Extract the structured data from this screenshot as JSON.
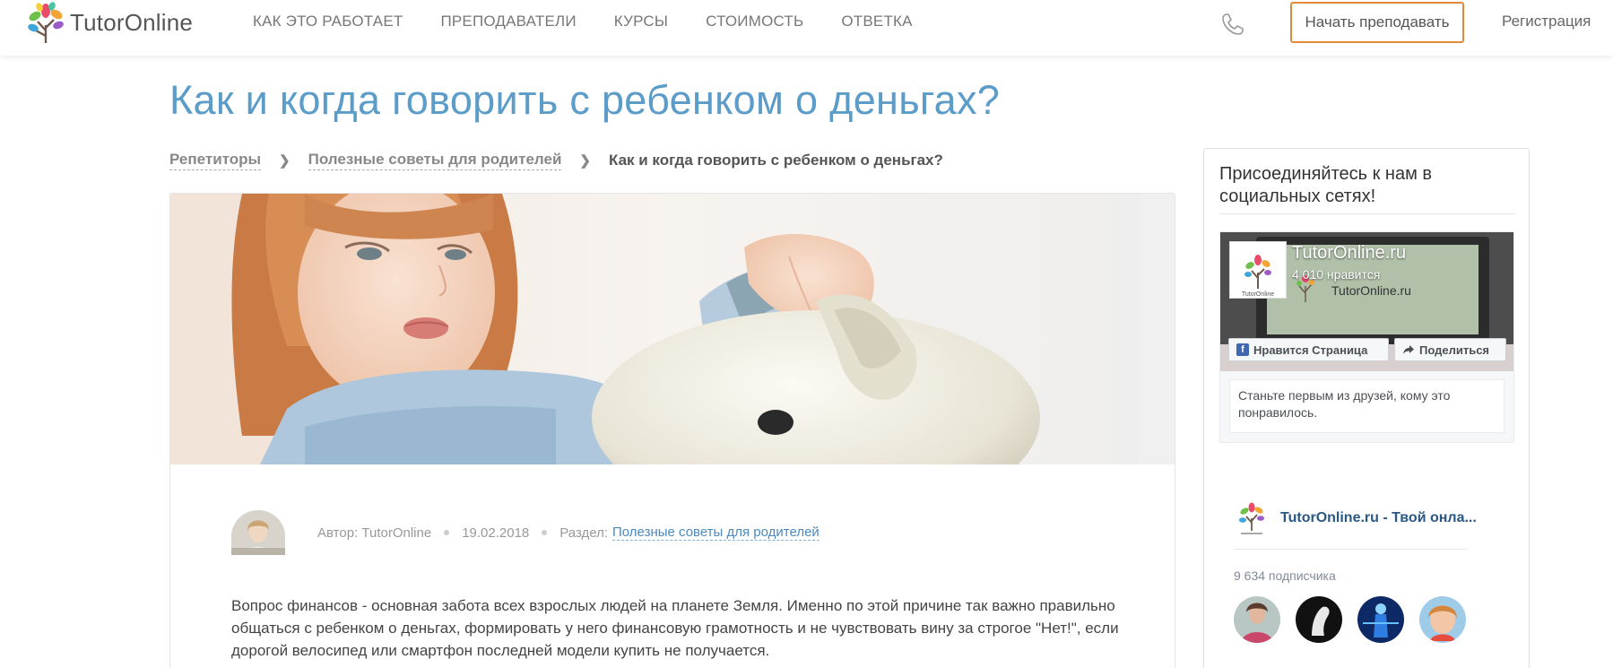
{
  "header": {
    "logo_text": "TutorOnline",
    "nav": [
      "КАК ЭТО РАБОТАЕТ",
      "ПРЕПОДАВАТЕЛИ",
      "КУРСЫ",
      "СТОИМОСТЬ",
      "ОТВЕТКА"
    ],
    "start_teaching_label": "Начать преподавать",
    "register_label": "Регистрация"
  },
  "page": {
    "title": "Как и когда говорить с ребенком о деньгах?"
  },
  "breadcrumb": {
    "items": [
      "Репетиторы",
      "Полезные советы для родителей"
    ],
    "current": "Как и когда говорить с ребенком о деньгах?"
  },
  "article": {
    "author": "Автор: TutorOnline",
    "date": "19.02.2018",
    "section_label": "Раздел:",
    "section_link": "Полезные советы для родителей",
    "paragraph": "Вопрос финансов - основная забота всех взрослых людей на планете Земля. Именно по этой причине так важно правильно общаться с ребенком о деньгах, формировать у него финансовую грамотность и не чувствовать вину за строгое \"Нет!\", если дорогой велосипед или смартфон последней модели купить не получается."
  },
  "sidebar": {
    "title": "Присоединяйтесь к нам в социальных сетях!",
    "facebook": {
      "page_name": "TutorOnline.ru",
      "likes": "4 010 нравится",
      "cover_text": "TutorOnline.ru",
      "like_button": "Нравится Страница",
      "share_button": "Поделиться",
      "friends_text": "Станьте первым из друзей, кому это понравилось."
    },
    "vk": {
      "name": "TutorOnline.ru - Твой онла...",
      "subscribers": "9 634 подписчика"
    }
  },
  "colors": {
    "accent_blue": "#5b9cc9",
    "button_orange": "#e08a3c",
    "link_blue": "#4a8ac0",
    "vk_blue": "#2a5885",
    "fb_blue": "#4267b2"
  },
  "icons": [
    "tree-logo-icon",
    "phone-icon",
    "chevron-right-icon",
    "facebook-f-icon",
    "share-arrow-icon"
  ]
}
